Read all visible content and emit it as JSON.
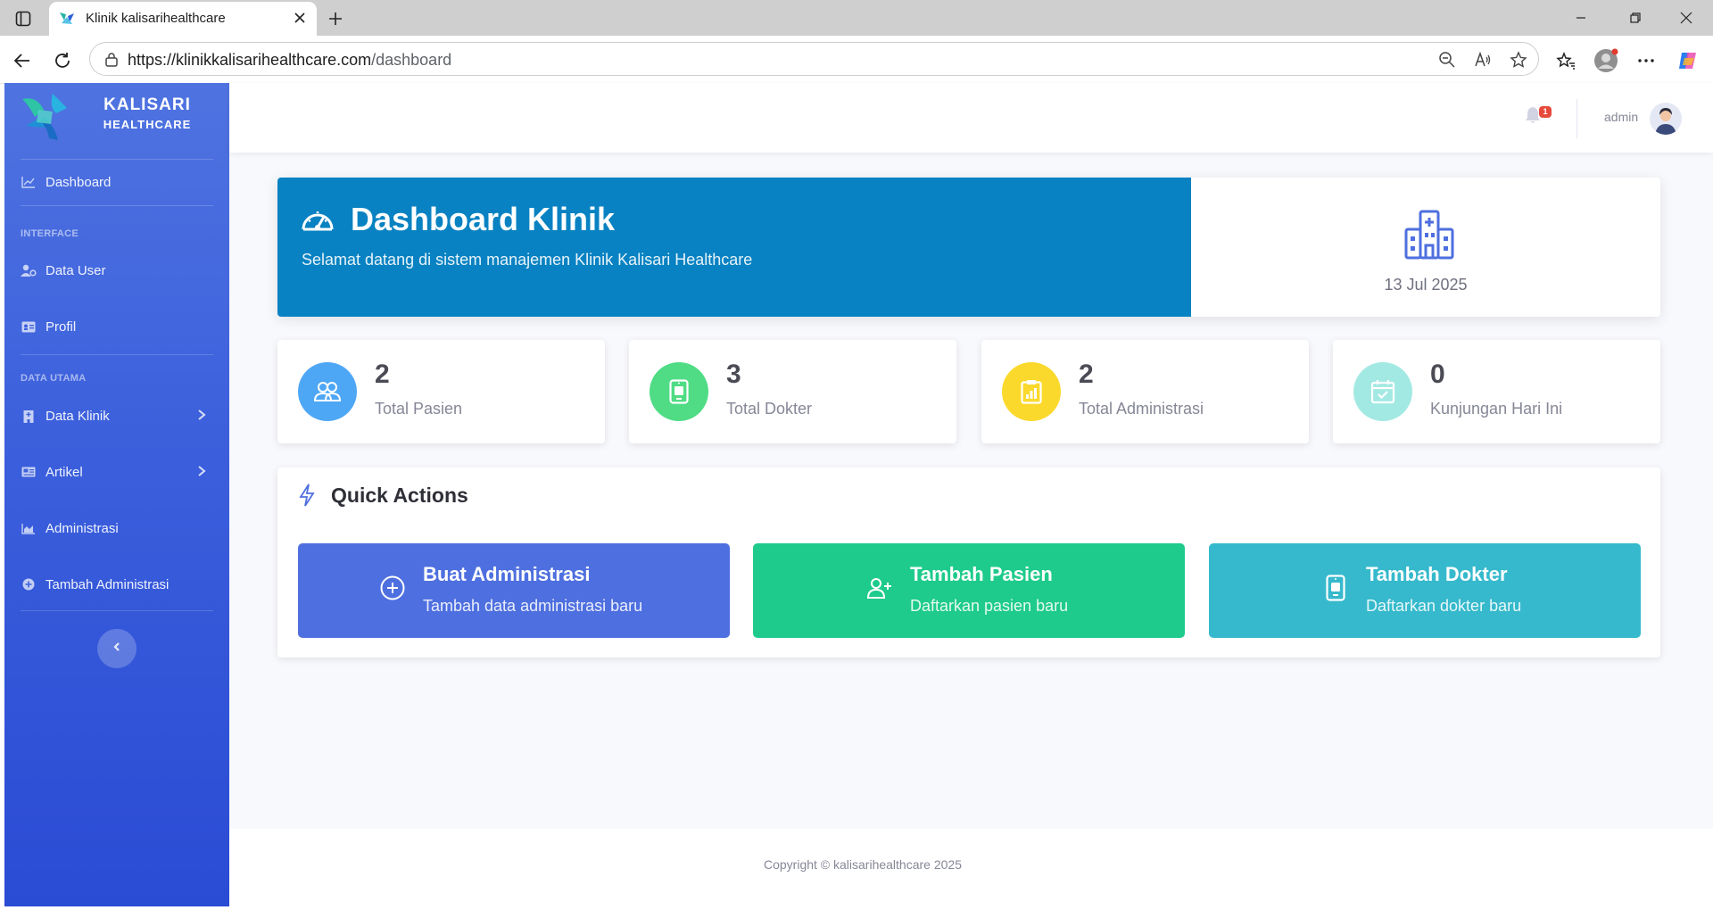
{
  "browser": {
    "tab_title": "Klinik kalisarihealthcare",
    "url_host": "https://klinikkalisarihealthcare.com",
    "url_path": "/dashboard"
  },
  "sidebar": {
    "brand_line1": "KALISARI",
    "brand_line2": "HEALTHCARE",
    "items": [
      {
        "label": "Dashboard",
        "icon": "chart-line-icon"
      },
      {
        "label": "Data User",
        "icon": "user-cog-icon"
      },
      {
        "label": "Profil",
        "icon": "id-card-icon"
      },
      {
        "label": "Data Klinik",
        "icon": "hospital-icon",
        "has_submenu": true
      },
      {
        "label": "Artikel",
        "icon": "newspaper-icon",
        "has_submenu": true
      },
      {
        "label": "Administrasi",
        "icon": "chart-area-icon"
      },
      {
        "label": "Tambah Administrasi",
        "icon": "plus-circle-icon"
      }
    ],
    "headings": [
      "INTERFACE",
      "DATA UTAMA"
    ]
  },
  "topbar": {
    "notification_count": "1",
    "username": "admin"
  },
  "hero": {
    "title": "Dashboard Klinik",
    "subtitle": "Selamat datang di sistem manajemen Klinik Kalisari Healthcare",
    "date": "13 Jul 2025"
  },
  "stats": [
    {
      "value": "2",
      "label": "Total Pasien",
      "color": "#4ea7f5"
    },
    {
      "value": "3",
      "label": "Total Dokter",
      "color": "#4fdc84"
    },
    {
      "value": "2",
      "label": "Total Administrasi",
      "color": "#fbd92c"
    },
    {
      "value": "0",
      "label": "Kunjungan Hari Ini",
      "color": "#a3e9e3"
    }
  ],
  "quick_actions": {
    "title": "Quick Actions",
    "buttons": [
      {
        "title": "Buat Administrasi",
        "subtitle": "Tambah data administrasi baru",
        "color": "#4e6fdf"
      },
      {
        "title": "Tambah Pasien",
        "subtitle": "Daftarkan pasien baru",
        "color": "#1ecb8c"
      },
      {
        "title": "Tambah Dokter",
        "subtitle": "Daftarkan dokter baru",
        "color": "#36b9cc"
      }
    ]
  },
  "footer": {
    "copyright": "Copyright © kalisarihealthcare 2025"
  }
}
